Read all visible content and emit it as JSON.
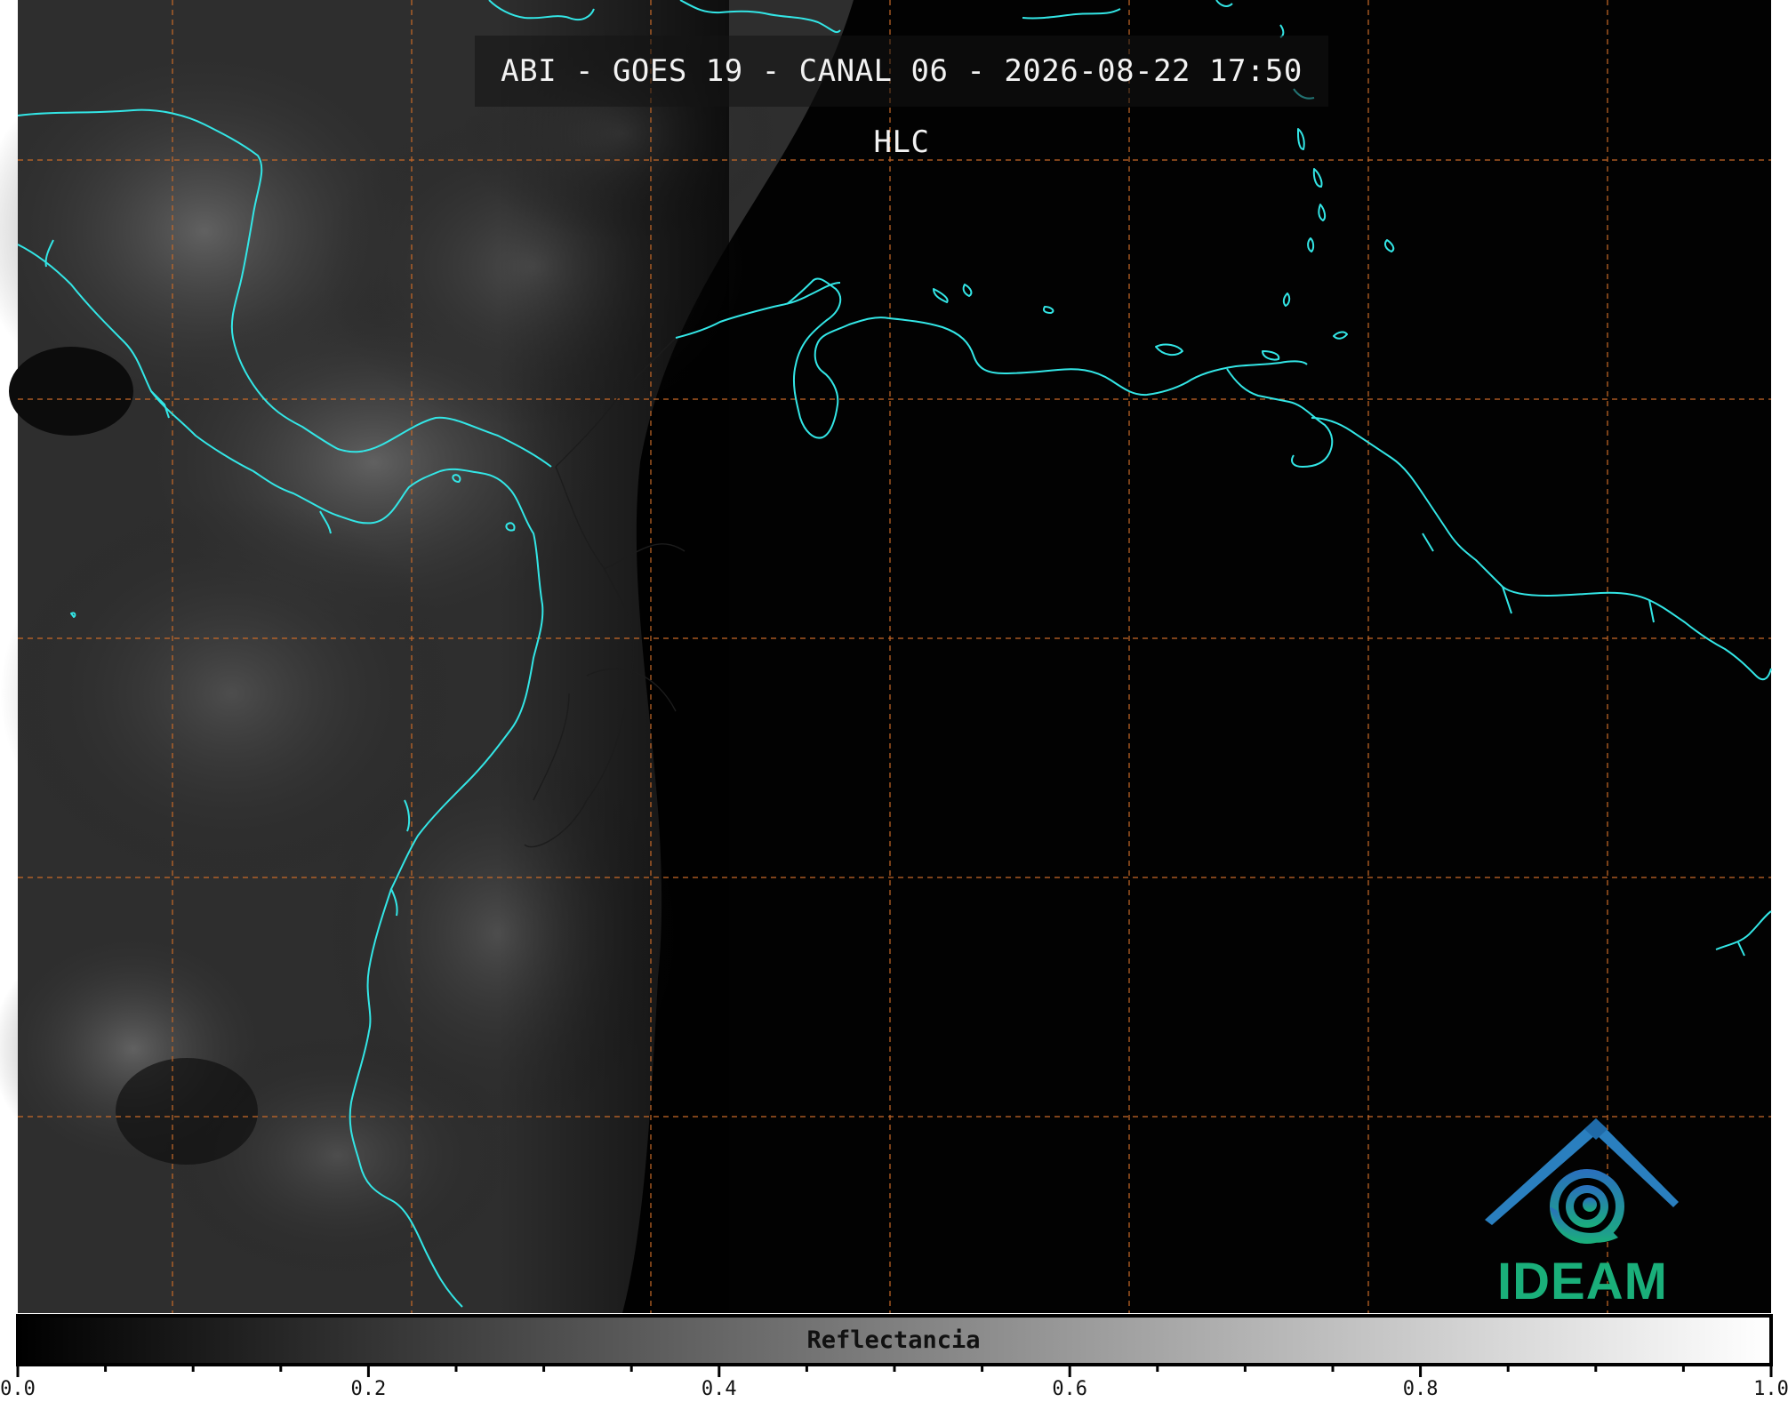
{
  "map": {
    "title": "ABI - GOES 19 - CANAL 06 - 2026-08-22 17:50 HLC",
    "colorbar": {
      "label": "Reflectancia",
      "min": 0.0,
      "max": 1.0,
      "ticks": [
        "0.0",
        "0.2",
        "0.4",
        "0.6",
        "0.8",
        "1.0"
      ]
    },
    "logo": {
      "text": "IDEAM"
    },
    "colors": {
      "coastline": "#33e6e6",
      "gridline": "#c86a28",
      "borders": "#222222",
      "logo_blue": "#2a7fbf",
      "logo_green": "#1aaf7a"
    }
  }
}
